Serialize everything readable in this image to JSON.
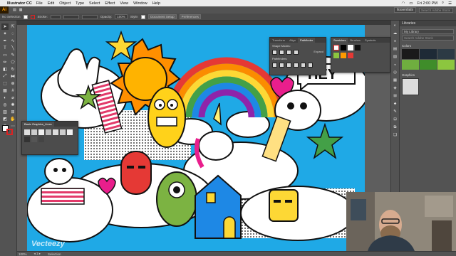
{
  "menubar": {
    "app_name": "Illustrator CC",
    "items": [
      "File",
      "Edit",
      "Object",
      "Type",
      "Select",
      "Effect",
      "View",
      "Window",
      "Help"
    ],
    "clock": "Fri 2:00 PM"
  },
  "appbar": {
    "logo": "Ai",
    "workspace": "Essentials",
    "search_placeholder": "Search Adobe Stock"
  },
  "control_bar": {
    "selection": "No Selection",
    "stroke_label": "Stroke:",
    "opacity_label": "Opacity:",
    "opacity_value": "100%",
    "style_label": "Style:",
    "doc_setup": "Document Setup",
    "preferences": "Preferences"
  },
  "panels": {
    "pathfinder": {
      "tabs": [
        "Transform",
        "Align",
        "Pathfinder"
      ],
      "active_tab": "Pathfinder",
      "shape_modes": "Shape Modes:",
      "pathfinders": "Pathfinders:",
      "expand": "Expand"
    },
    "swatches": {
      "tabs": [
        "Swatches",
        "Brushes",
        "Symbols"
      ],
      "active_tab": "Swatches"
    },
    "graphic_styles": {
      "title": "Basic Graphics_Lines"
    },
    "libraries": {
      "title": "Libraries",
      "library": "My Library",
      "search_placeholder": "Search Adobe Stock",
      "colors_section": "Colors",
      "graphics_section": "Graphics",
      "colors": [
        "#1a1a1a",
        "#1e2a36",
        "#2c3a44",
        "#6fae3f",
        "#3f8d2a",
        "#8cc63f"
      ]
    }
  },
  "artwork": {
    "speech_bubble": "HEY",
    "watermark": "Vecteezy"
  },
  "status": {
    "zoom": "100%",
    "tool": "Selection"
  },
  "colors": {
    "artboard_bg": "#1fa9e6",
    "accent_orange": "#ff9a00"
  }
}
